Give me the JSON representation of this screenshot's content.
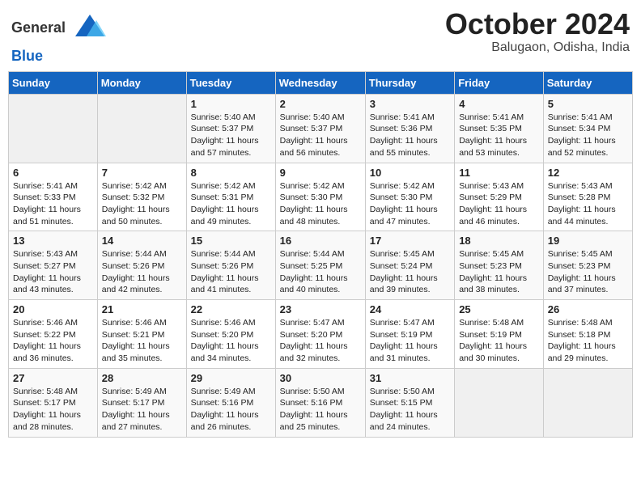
{
  "header": {
    "logo_general": "General",
    "logo_blue": "Blue",
    "title": "October 2024",
    "subtitle": "Balugaon, Odisha, India"
  },
  "days_of_week": [
    "Sunday",
    "Monday",
    "Tuesday",
    "Wednesday",
    "Thursday",
    "Friday",
    "Saturday"
  ],
  "weeks": [
    [
      {
        "day": "",
        "info": ""
      },
      {
        "day": "",
        "info": ""
      },
      {
        "day": "1",
        "sunrise": "Sunrise: 5:40 AM",
        "sunset": "Sunset: 5:37 PM",
        "daylight": "Daylight: 11 hours and 57 minutes."
      },
      {
        "day": "2",
        "sunrise": "Sunrise: 5:40 AM",
        "sunset": "Sunset: 5:37 PM",
        "daylight": "Daylight: 11 hours and 56 minutes."
      },
      {
        "day": "3",
        "sunrise": "Sunrise: 5:41 AM",
        "sunset": "Sunset: 5:36 PM",
        "daylight": "Daylight: 11 hours and 55 minutes."
      },
      {
        "day": "4",
        "sunrise": "Sunrise: 5:41 AM",
        "sunset": "Sunset: 5:35 PM",
        "daylight": "Daylight: 11 hours and 53 minutes."
      },
      {
        "day": "5",
        "sunrise": "Sunrise: 5:41 AM",
        "sunset": "Sunset: 5:34 PM",
        "daylight": "Daylight: 11 hours and 52 minutes."
      }
    ],
    [
      {
        "day": "6",
        "sunrise": "Sunrise: 5:41 AM",
        "sunset": "Sunset: 5:33 PM",
        "daylight": "Daylight: 11 hours and 51 minutes."
      },
      {
        "day": "7",
        "sunrise": "Sunrise: 5:42 AM",
        "sunset": "Sunset: 5:32 PM",
        "daylight": "Daylight: 11 hours and 50 minutes."
      },
      {
        "day": "8",
        "sunrise": "Sunrise: 5:42 AM",
        "sunset": "Sunset: 5:31 PM",
        "daylight": "Daylight: 11 hours and 49 minutes."
      },
      {
        "day": "9",
        "sunrise": "Sunrise: 5:42 AM",
        "sunset": "Sunset: 5:30 PM",
        "daylight": "Daylight: 11 hours and 48 minutes."
      },
      {
        "day": "10",
        "sunrise": "Sunrise: 5:42 AM",
        "sunset": "Sunset: 5:30 PM",
        "daylight": "Daylight: 11 hours and 47 minutes."
      },
      {
        "day": "11",
        "sunrise": "Sunrise: 5:43 AM",
        "sunset": "Sunset: 5:29 PM",
        "daylight": "Daylight: 11 hours and 46 minutes."
      },
      {
        "day": "12",
        "sunrise": "Sunrise: 5:43 AM",
        "sunset": "Sunset: 5:28 PM",
        "daylight": "Daylight: 11 hours and 44 minutes."
      }
    ],
    [
      {
        "day": "13",
        "sunrise": "Sunrise: 5:43 AM",
        "sunset": "Sunset: 5:27 PM",
        "daylight": "Daylight: 11 hours and 43 minutes."
      },
      {
        "day": "14",
        "sunrise": "Sunrise: 5:44 AM",
        "sunset": "Sunset: 5:26 PM",
        "daylight": "Daylight: 11 hours and 42 minutes."
      },
      {
        "day": "15",
        "sunrise": "Sunrise: 5:44 AM",
        "sunset": "Sunset: 5:26 PM",
        "daylight": "Daylight: 11 hours and 41 minutes."
      },
      {
        "day": "16",
        "sunrise": "Sunrise: 5:44 AM",
        "sunset": "Sunset: 5:25 PM",
        "daylight": "Daylight: 11 hours and 40 minutes."
      },
      {
        "day": "17",
        "sunrise": "Sunrise: 5:45 AM",
        "sunset": "Sunset: 5:24 PM",
        "daylight": "Daylight: 11 hours and 39 minutes."
      },
      {
        "day": "18",
        "sunrise": "Sunrise: 5:45 AM",
        "sunset": "Sunset: 5:23 PM",
        "daylight": "Daylight: 11 hours and 38 minutes."
      },
      {
        "day": "19",
        "sunrise": "Sunrise: 5:45 AM",
        "sunset": "Sunset: 5:23 PM",
        "daylight": "Daylight: 11 hours and 37 minutes."
      }
    ],
    [
      {
        "day": "20",
        "sunrise": "Sunrise: 5:46 AM",
        "sunset": "Sunset: 5:22 PM",
        "daylight": "Daylight: 11 hours and 36 minutes."
      },
      {
        "day": "21",
        "sunrise": "Sunrise: 5:46 AM",
        "sunset": "Sunset: 5:21 PM",
        "daylight": "Daylight: 11 hours and 35 minutes."
      },
      {
        "day": "22",
        "sunrise": "Sunrise: 5:46 AM",
        "sunset": "Sunset: 5:20 PM",
        "daylight": "Daylight: 11 hours and 34 minutes."
      },
      {
        "day": "23",
        "sunrise": "Sunrise: 5:47 AM",
        "sunset": "Sunset: 5:20 PM",
        "daylight": "Daylight: 11 hours and 32 minutes."
      },
      {
        "day": "24",
        "sunrise": "Sunrise: 5:47 AM",
        "sunset": "Sunset: 5:19 PM",
        "daylight": "Daylight: 11 hours and 31 minutes."
      },
      {
        "day": "25",
        "sunrise": "Sunrise: 5:48 AM",
        "sunset": "Sunset: 5:19 PM",
        "daylight": "Daylight: 11 hours and 30 minutes."
      },
      {
        "day": "26",
        "sunrise": "Sunrise: 5:48 AM",
        "sunset": "Sunset: 5:18 PM",
        "daylight": "Daylight: 11 hours and 29 minutes."
      }
    ],
    [
      {
        "day": "27",
        "sunrise": "Sunrise: 5:48 AM",
        "sunset": "Sunset: 5:17 PM",
        "daylight": "Daylight: 11 hours and 28 minutes."
      },
      {
        "day": "28",
        "sunrise": "Sunrise: 5:49 AM",
        "sunset": "Sunset: 5:17 PM",
        "daylight": "Daylight: 11 hours and 27 minutes."
      },
      {
        "day": "29",
        "sunrise": "Sunrise: 5:49 AM",
        "sunset": "Sunset: 5:16 PM",
        "daylight": "Daylight: 11 hours and 26 minutes."
      },
      {
        "day": "30",
        "sunrise": "Sunrise: 5:50 AM",
        "sunset": "Sunset: 5:16 PM",
        "daylight": "Daylight: 11 hours and 25 minutes."
      },
      {
        "day": "31",
        "sunrise": "Sunrise: 5:50 AM",
        "sunset": "Sunset: 5:15 PM",
        "daylight": "Daylight: 11 hours and 24 minutes."
      },
      {
        "day": "",
        "info": ""
      },
      {
        "day": "",
        "info": ""
      }
    ]
  ]
}
